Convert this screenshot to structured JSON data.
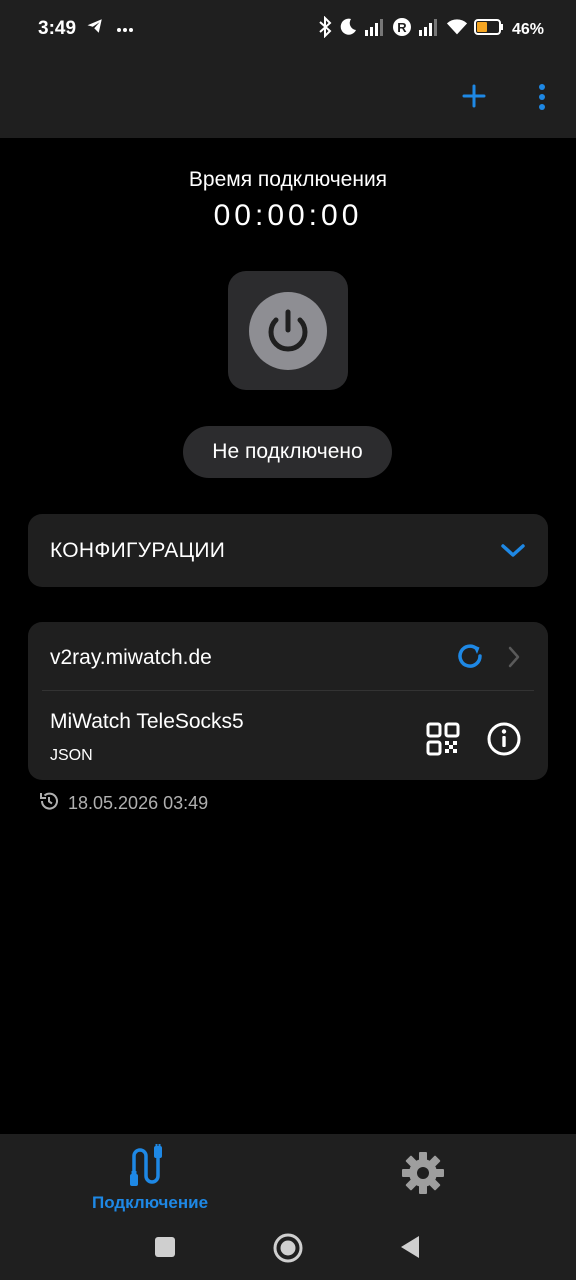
{
  "status_bar": {
    "time": "3:49",
    "battery_percent": "46%",
    "battery_level": 0.46,
    "icons": [
      "telegram-icon",
      "more-dots-icon",
      "bluetooth-icon",
      "moon-icon",
      "signal-icon",
      "roaming-icon",
      "signal-icon",
      "wifi-icon",
      "battery-icon"
    ]
  },
  "app_bar": {
    "actions": [
      "add-icon",
      "more-vert-icon"
    ]
  },
  "connection": {
    "timer_label": "Время подключения",
    "timer_value": "00:00:00",
    "status_text": "Не подключено"
  },
  "configs": {
    "section_title": "КОНФИГУРАЦИИ"
  },
  "subscription": {
    "url": "v2ray.miwatch.de",
    "profile_name": "MiWatch TeleSocks5",
    "profile_type": "JSON",
    "updated_at": "18.05.2026 03:49"
  },
  "bottom_nav": {
    "connect_label": "Подключение"
  },
  "colors": {
    "accent": "#1e88e5",
    "background": "#000000",
    "surface": "#1f1f1f",
    "surface_alt": "#2c2c2e"
  }
}
